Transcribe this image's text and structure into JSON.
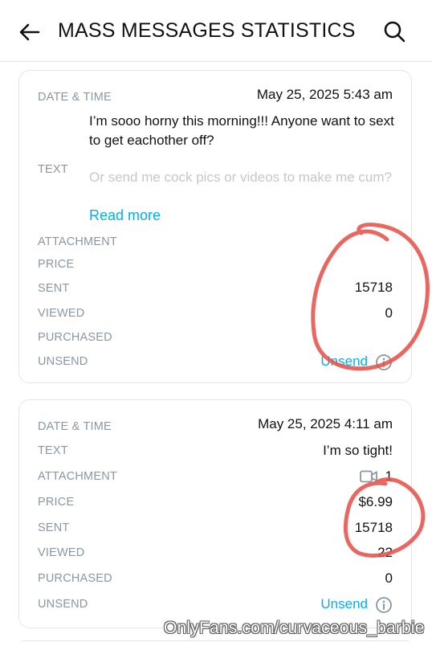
{
  "header": {
    "title": "MASS MESSAGES STATISTICS",
    "back_icon": "arrow-left-icon",
    "search_icon": "search-icon"
  },
  "labels": {
    "date_time": "DATE & TIME",
    "text": "TEXT",
    "attachment": "ATTACHMENT",
    "price": "PRICE",
    "sent": "SENT",
    "viewed": "VIEWED",
    "purchased": "PURCHASED",
    "unsend": "UNSEND"
  },
  "messages": [
    {
      "date_time": "May 25, 2025 5:43 am",
      "text_preview": "I’m sooo horny this morning!!! Anyone want to sext to get eachother off?",
      "text_faded": "Or send me cock pics or videos to make me cum? (For tips, no unsolicited or you’ll be",
      "read_more": "Read more",
      "attachment": "",
      "price": "",
      "sent": "15718",
      "viewed": "0",
      "purchased": "",
      "unsend_label": "Unsend"
    },
    {
      "date_time": "May 25, 2025 4:11 am",
      "text_preview": "I’m so tight!",
      "attachment_icon": "video-icon",
      "attachment": "1",
      "price": "$6.99",
      "sent": "15718",
      "viewed": "22",
      "purchased": "0",
      "unsend_label": "Unsend"
    }
  ],
  "watermark": "OnlyFans.com/curvaceous_barbie",
  "colors": {
    "accent": "#00aff0",
    "label": "#8a96a3",
    "annotation": "#e5534b"
  }
}
